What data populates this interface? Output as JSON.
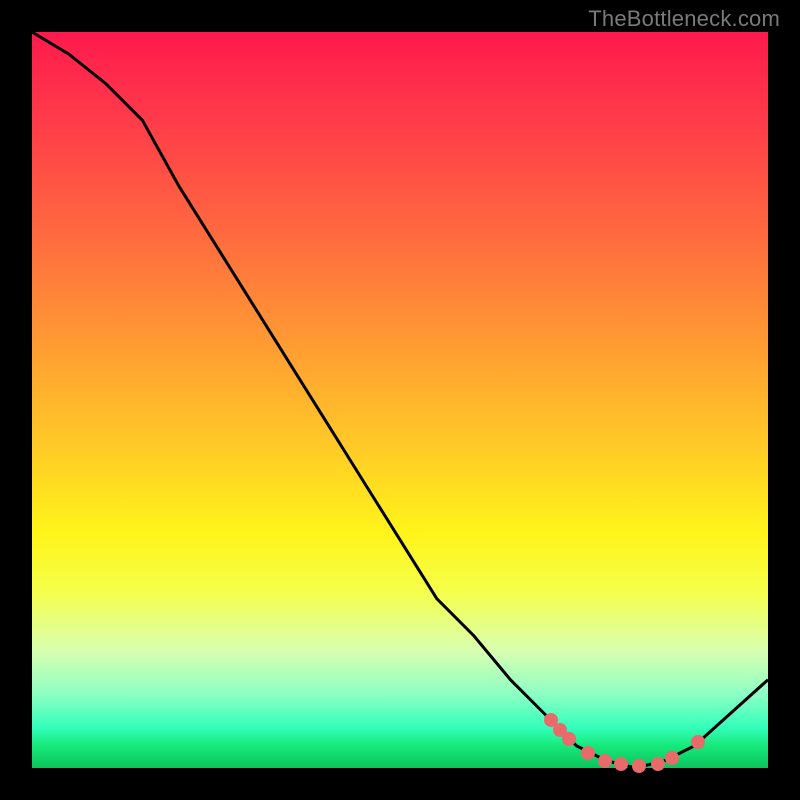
{
  "watermark": "TheBottleneck.com",
  "chart_data": {
    "type": "line",
    "title": "",
    "xlabel": "",
    "ylabel": "",
    "xlim": [
      0,
      100
    ],
    "ylim": [
      0,
      100
    ],
    "series": [
      {
        "name": "bottleneck-curve",
        "x": [
          0,
          5,
          10,
          15,
          20,
          25,
          30,
          35,
          40,
          45,
          50,
          55,
          60,
          65,
          70,
          74,
          78,
          82,
          86,
          90,
          100
        ],
        "y": [
          100,
          97,
          93,
          88,
          79,
          71,
          63,
          55,
          47,
          39,
          31,
          23,
          18,
          12,
          7,
          3,
          1,
          0,
          1,
          3,
          12
        ]
      }
    ],
    "dots": {
      "name": "highlight-points",
      "x": [
        70.5,
        71.8,
        73.0,
        75.5,
        77.8,
        80.0,
        82.5,
        85.0,
        87.0,
        90.5
      ],
      "y": [
        6.5,
        5.2,
        4.0,
        2.0,
        1.0,
        0.5,
        0.3,
        0.6,
        1.3,
        3.5
      ]
    }
  }
}
